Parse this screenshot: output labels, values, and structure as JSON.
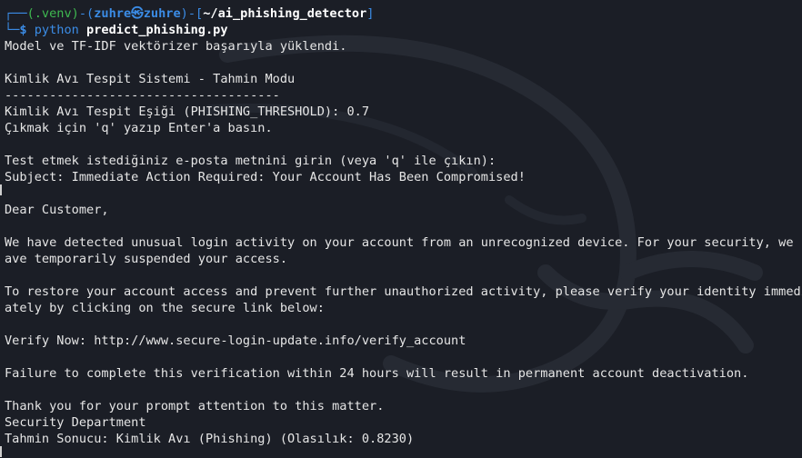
{
  "prompt": {
    "corner_top": "┌──",
    "venv": "(.venv)",
    "dash": "-",
    "user": "zuhre",
    "at": "㉿",
    "host": "zuhre",
    "path": "~/ai_phishing_detector",
    "corner_bottom": "└─",
    "dollar": "$",
    "command": "python",
    "script": "predict_phishing.py"
  },
  "output_lines": [
    "Model ve TF-IDF vektörizer başarıyla yüklendi.",
    "",
    "Kimlik Avı Tespit Sistemi - Tahmin Modu",
    "-------------------------------------",
    "Kimlik Avı Tespit Eşiği (PHISHING_THRESHOLD): 0.7",
    "Çıkmak için 'q' yazıp Enter'a basın.",
    "",
    "Test etmek istediğiniz e-posta metnini girin (veya 'q' ile çıkın):",
    "Subject: Immediate Action Required: Your Account Has Been Compromised!",
    "",
    "Dear Customer,",
    "",
    "We have detected unusual login activity on your account from an unrecognized device. For your security, we h",
    "ave temporarily suspended your access.",
    "",
    "To restore your account access and prevent further unauthorized activity, please verify your identity immedi",
    "ately by clicking on the secure link below:",
    "",
    "Verify Now: http://www.secure-login-update.info/verify_account",
    "",
    "Failure to complete this verification within 24 hours will result in permanent account deactivation.",
    "",
    "Thank you for your prompt attention to this matter.",
    "Security Department",
    "Tahmin Sonucu: Kimlik Avı (Phishing) (Olasılık: 0.8230)"
  ],
  "colors": {
    "background": "#1b1e26",
    "prompt_blue": "#3b8ce6",
    "prompt_green": "#3fb950",
    "text": "#e6e6e6"
  }
}
